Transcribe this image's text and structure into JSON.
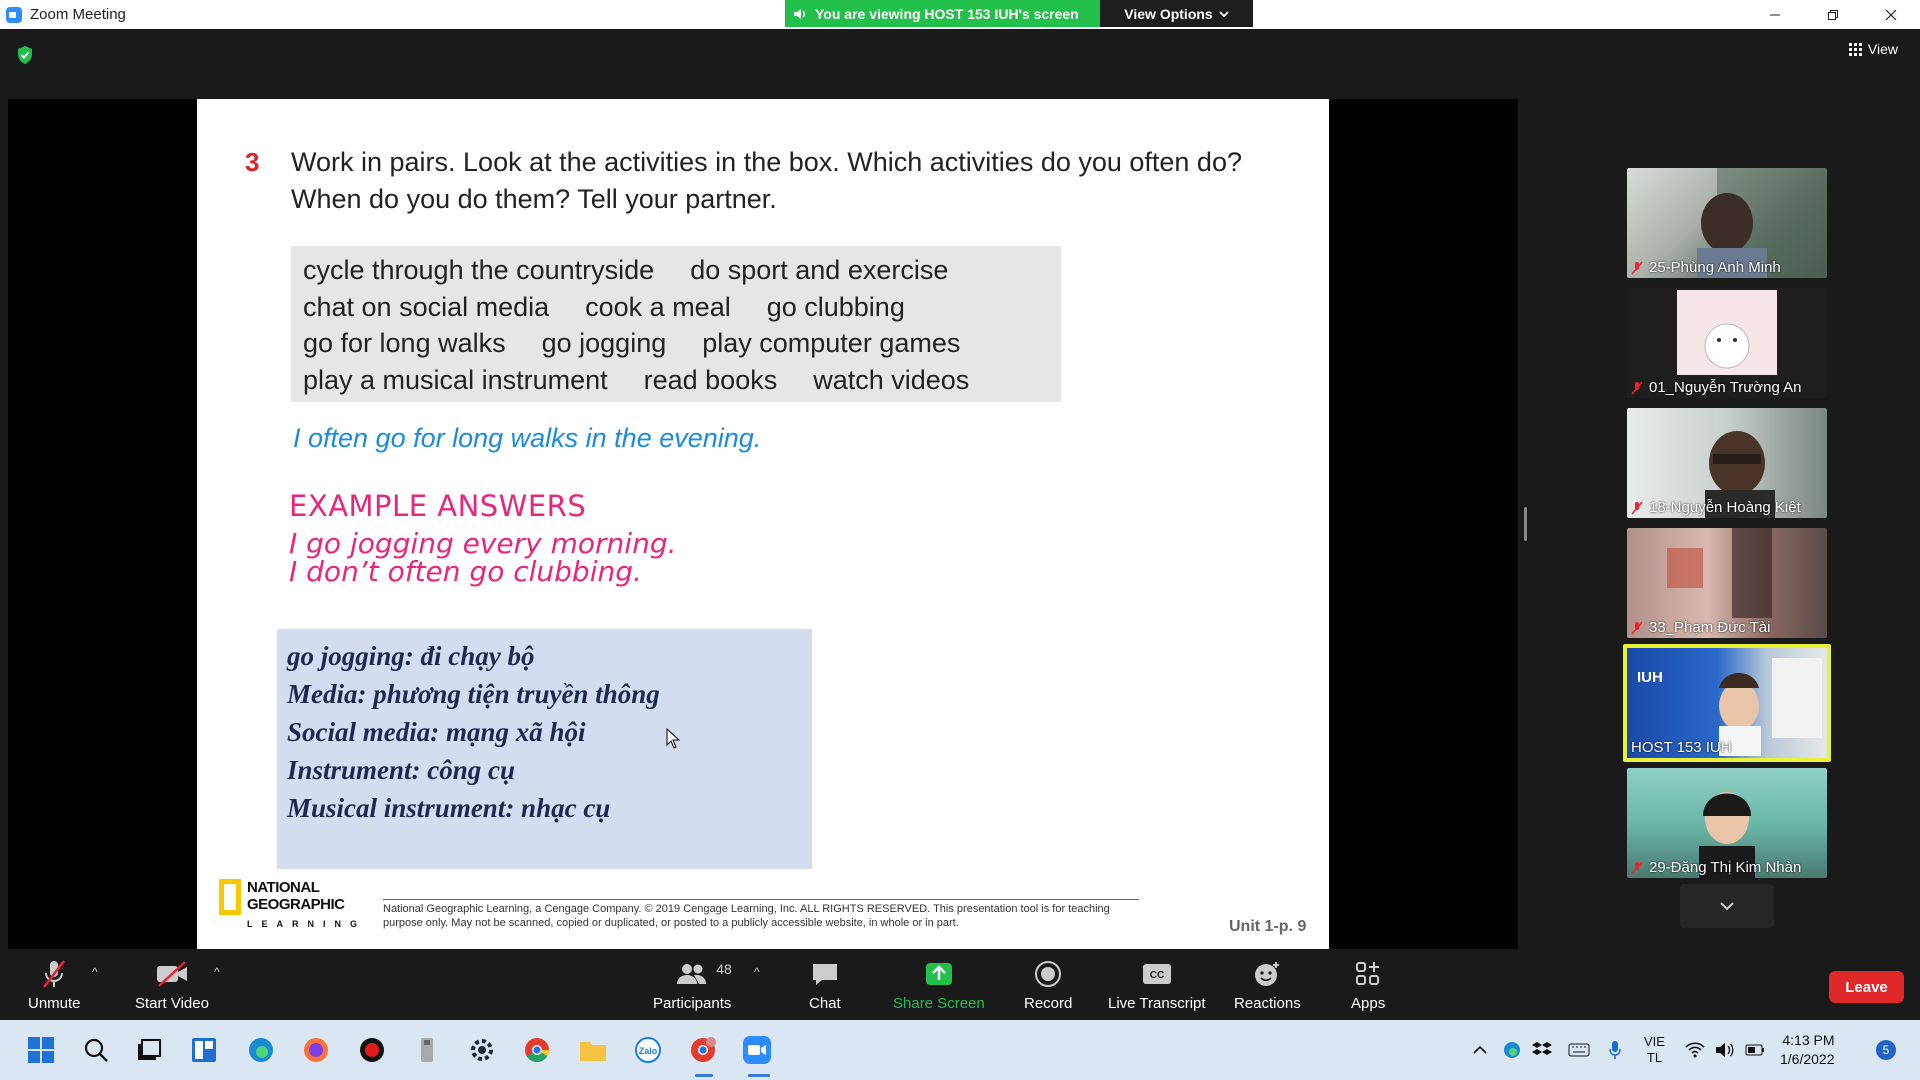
{
  "window": {
    "title": "Zoom Meeting",
    "viewing_banner": "You are viewing HOST 153 IUH's screen",
    "view_options": "View Options",
    "view_button": "View"
  },
  "slide": {
    "question_number": "3",
    "question_text": "Work in pairs. Look at the activities  in the box. Which activities  do you often do? When do you do them? Tell your partner.",
    "activity_lines": [
      [
        "cycle through the countryside",
        "do sport and exercise"
      ],
      [
        "chat on social media",
        "cook a meal",
        "go clubbing"
      ],
      [
        "go for long walks",
        "go jogging",
        "play computer games"
      ],
      [
        "play a musical instrument",
        "read books",
        "watch videos"
      ]
    ],
    "example_sentence": "I often go for long walks in the evening.",
    "example_answers_title": "EXAMPLE ANSWERS",
    "example_answers": [
      "I go jogging every morning.",
      "I don’t often go clubbing."
    ],
    "vocab": [
      "go jogging: đi chạy bộ",
      "Media: phương tiện truyền  thông",
      "Social media: mạng xã hội",
      "Instrument:  công cụ",
      "Musical instrument:  nhạc cụ"
    ],
    "logo_line1": "NATIONAL",
    "logo_line2": "GEOGRAPHIC",
    "logo_line3": "LEARNING",
    "copyright": "National Geographic Learning, a Cengage Company. © 2019 Cengage Learning, Inc. ALL RIGHTS RESERVED. This presentation tool is for teaching purpose only. May not be scanned, copied or duplicated, or posted to a publicly accessible website, in whole or in part.",
    "unit_label": "Unit 1-p. 9"
  },
  "participants": [
    {
      "name": "25-Phùng Anh Minh",
      "muted": true
    },
    {
      "name": "01_Nguyễn Trường An",
      "muted": true
    },
    {
      "name": "18-Nguyễn Hoàng Kiệt",
      "muted": true
    },
    {
      "name": "33_Phạm Đức Tài",
      "muted": true
    },
    {
      "name": "HOST 153 IUH",
      "muted": false
    },
    {
      "name": "29-Đặng Thị Kim Nhàn",
      "muted": true
    }
  ],
  "host_tile": {
    "brand": "IUH"
  },
  "toolbar": {
    "unmute": "Unmute",
    "start_video": "Start Video",
    "participants": "Participants",
    "participants_count": "48",
    "chat": "Chat",
    "share_screen": "Share Screen",
    "record": "Record",
    "live_transcript": "Live Transcript",
    "live_transcript_icon_text": "CC",
    "reactions": "Reactions",
    "apps": "Apps",
    "leave": "Leave"
  },
  "taskbar": {
    "language_line1": "VIE",
    "language_line2": "TL",
    "time": "4:13 PM",
    "date": "1/6/2022",
    "notifications": "5",
    "zalo_label": "Zalo"
  },
  "colors": {
    "banner_green": "#22c04a",
    "leave_red": "#e02828",
    "share_green": "#22c04a",
    "active_speaker": "#e6f13a",
    "question_red": "#d9252a",
    "example_blue": "#1c8adf",
    "example_pink": "#e8267c"
  }
}
